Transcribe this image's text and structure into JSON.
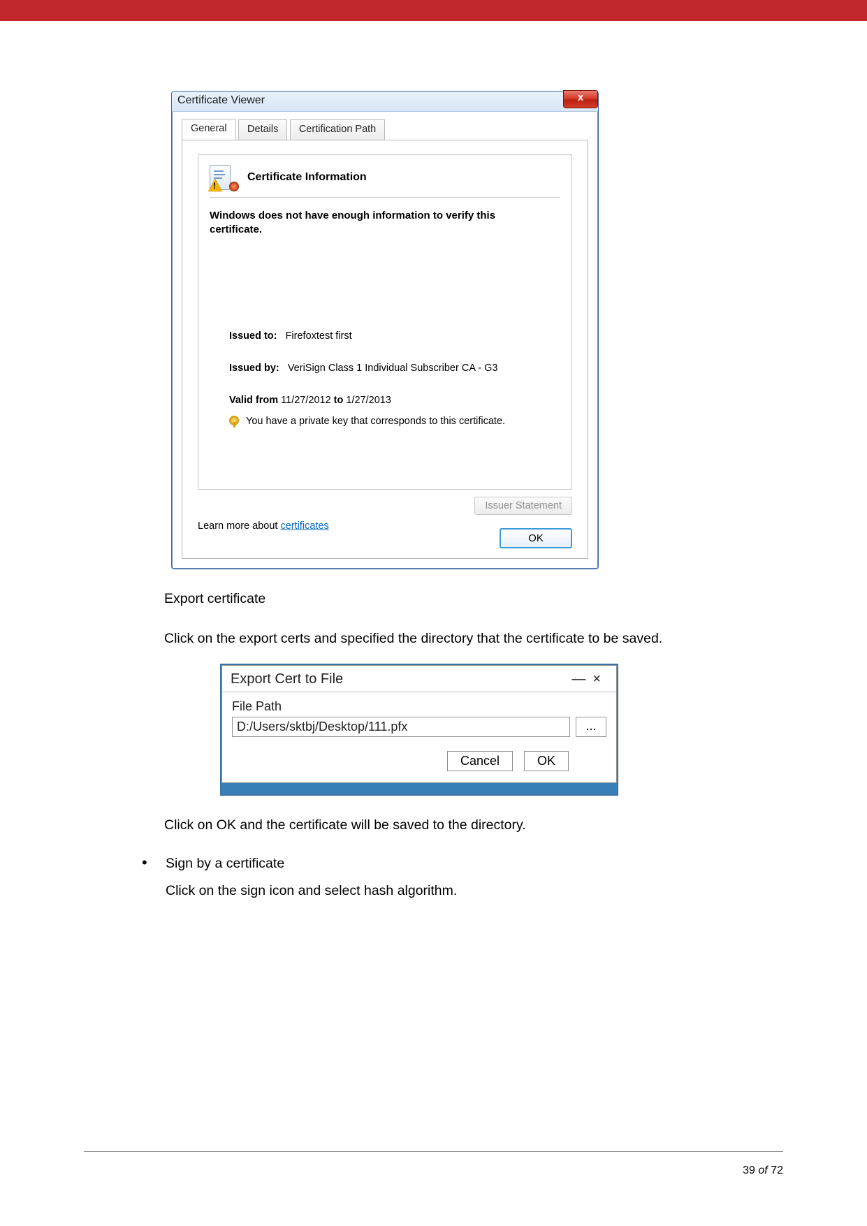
{
  "cert_viewer": {
    "window_title": "Certificate Viewer",
    "close_label": "x",
    "tabs": {
      "general": "General",
      "details": "Details",
      "path": "Certification Path"
    },
    "header": "Certificate Information",
    "message": "Windows does not have enough information to verify this certificate.",
    "issued_to_label": "Issued to:",
    "issued_to_value": "Firefoxtest first",
    "issued_by_label": "Issued by:",
    "issued_by_value": "VeriSign Class 1 Individual Subscriber CA - G3",
    "valid_from_label": "Valid from",
    "valid_from_value": "11/27/2012",
    "valid_to_label": "to",
    "valid_to_value": "1/27/2013",
    "key_note": "You have a private key that corresponds to this certificate.",
    "issuer_statement": "Issuer Statement",
    "learn_prefix": "Learn more about ",
    "learn_link": "certificates",
    "ok": "OK"
  },
  "body": {
    "export_heading": "Export certificate",
    "export_para": "Click on the export certs and specified the directory that the certificate to be saved.",
    "after_export": "Click on OK and the certificate will be saved to the directory.",
    "sign_heading": "Sign by a certificate",
    "sign_para": "Click on the sign icon and select hash algorithm."
  },
  "export_dialog": {
    "title": "Export Cert to File",
    "min": "—",
    "close": "×",
    "file_path_label": "File Path",
    "file_path_value": "D:/Users/sktbj/Desktop/111.pfx",
    "browse": "...",
    "cancel": "Cancel",
    "ok": "OK"
  },
  "footer": {
    "page": "39",
    "of": "of",
    "total": "72"
  }
}
